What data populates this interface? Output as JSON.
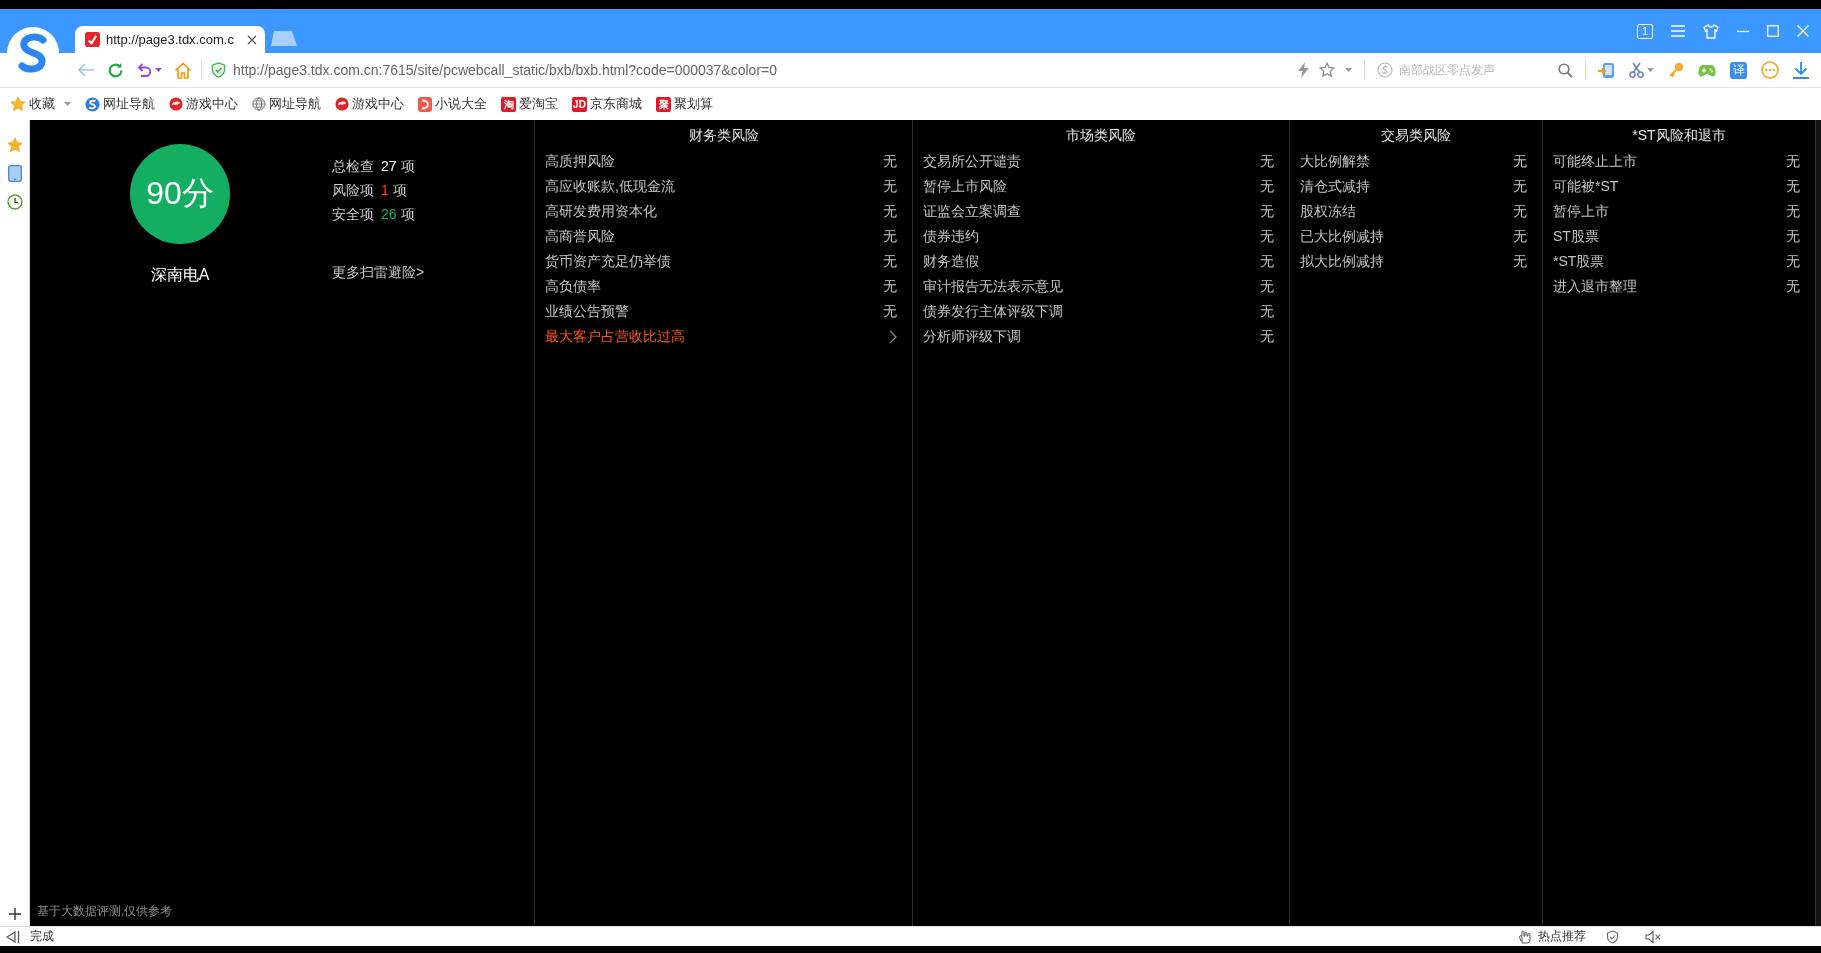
{
  "top_bar": {
    "tab": {
      "title": "http://page3.tdx.com.c"
    },
    "window_count": "1"
  },
  "address_bar": {
    "url": "http://page3.tdx.com.cn:7615/site/pcwebcall_static/bxb/bxb.html?code=000037&color=0",
    "search": {
      "placeholder": "南部战区零点发声"
    },
    "translate_glyph": "译"
  },
  "bookmarks": [
    {
      "label": "收藏",
      "dropdown": true
    },
    {
      "label": "网址导航",
      "dropdown": false
    },
    {
      "label": "游戏中心",
      "dropdown": false
    },
    {
      "label": "网址导航",
      "dropdown": false
    },
    {
      "label": "游戏中心",
      "dropdown": false
    },
    {
      "label": "小说大全",
      "dropdown": false
    },
    {
      "label": "爱淘宝",
      "badge": "淘",
      "dropdown": false
    },
    {
      "label": "京东商城",
      "badge": "JD",
      "dropdown": false
    },
    {
      "label": "聚划算",
      "badge": "聚",
      "dropdown": false
    }
  ],
  "score": {
    "value": "90分",
    "stock": "深南电A"
  },
  "stats": [
    {
      "label": "总检查",
      "count": "27",
      "unit": "项",
      "color": "#ffffff"
    },
    {
      "label": "风险项",
      "count": "1",
      "unit": "项",
      "color": "#ff4a00"
    },
    {
      "label": "安全项",
      "count": "26",
      "unit": "项",
      "color": "#17b65f"
    }
  ],
  "more_link": "更多扫雷避险>",
  "footer_note": "基于大数据评测,仅供参考",
  "categories": [
    {
      "title": "财务类风险",
      "items": [
        {
          "label": "高质押风险",
          "value": "无",
          "flagged": false
        },
        {
          "label": "高应收账款,低现金流",
          "value": "无",
          "flagged": false
        },
        {
          "label": "高研发费用资本化",
          "value": "无",
          "flagged": false
        },
        {
          "label": "高商誉风险",
          "value": "无",
          "flagged": false
        },
        {
          "label": "货币资产充足仍举债",
          "value": "无",
          "flagged": false
        },
        {
          "label": "高负债率",
          "value": "无",
          "flagged": false
        },
        {
          "label": "业绩公告预警",
          "value": "无",
          "flagged": false
        },
        {
          "label": "最大客户占营收比过高",
          "flagged": true
        }
      ]
    },
    {
      "title": "市场类风险",
      "items": [
        {
          "label": "交易所公开谴责",
          "value": "无",
          "flagged": false
        },
        {
          "label": "暂停上市风险",
          "value": "无",
          "flagged": false
        },
        {
          "label": "证监会立案调查",
          "value": "无",
          "flagged": false
        },
        {
          "label": "债券违约",
          "value": "无",
          "flagged": false
        },
        {
          "label": "财务造假",
          "value": "无",
          "flagged": false
        },
        {
          "label": "审计报告无法表示意见",
          "value": "无",
          "flagged": false
        },
        {
          "label": "债券发行主体评级下调",
          "value": "无",
          "flagged": false
        },
        {
          "label": "分析师评级下调",
          "value": "无",
          "flagged": false
        }
      ]
    },
    {
      "title": "交易类风险",
      "items": [
        {
          "label": "大比例解禁",
          "value": "无",
          "flagged": false
        },
        {
          "label": "清仓式减持",
          "value": "无",
          "flagged": false
        },
        {
          "label": "股权冻结",
          "value": "无",
          "flagged": false
        },
        {
          "label": "已大比例减持",
          "value": "无",
          "flagged": false
        },
        {
          "label": "拟大比例减持",
          "value": "无",
          "flagged": false
        }
      ]
    },
    {
      "title": "*ST风险和退市",
      "items": [
        {
          "label": "可能终止上市",
          "value": "无",
          "flagged": false
        },
        {
          "label": "可能被*ST",
          "value": "无",
          "flagged": false
        },
        {
          "label": "暂停上市",
          "value": "无",
          "flagged": false
        },
        {
          "label": "ST股票",
          "value": "无",
          "flagged": false
        },
        {
          "label": "*ST股票",
          "value": "无",
          "flagged": false
        },
        {
          "label": "进入退市整理",
          "value": "无",
          "flagged": false
        }
      ]
    }
  ],
  "status_bar": {
    "text": "完成",
    "hot_label": "热点推荐"
  }
}
